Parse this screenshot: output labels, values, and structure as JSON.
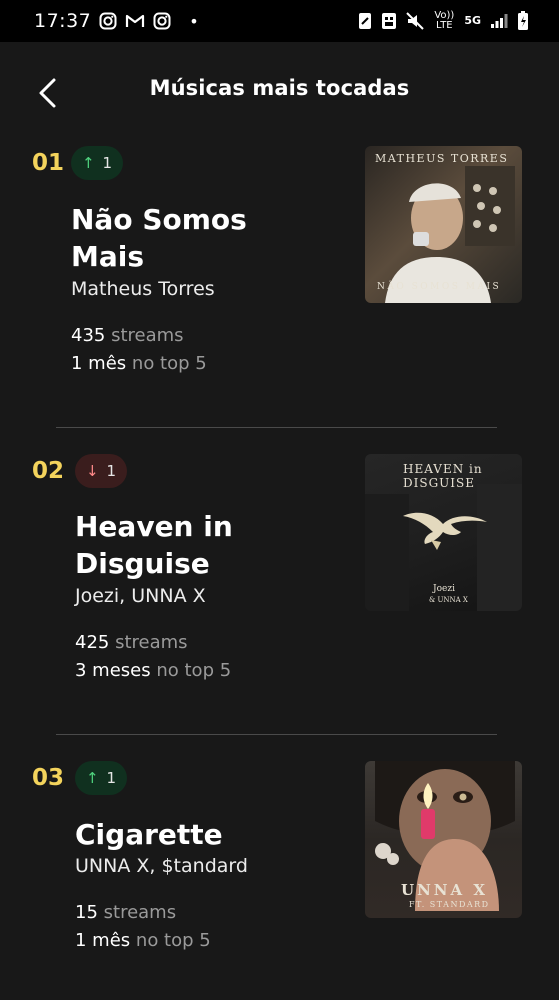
{
  "status_bar": {
    "time": "17:37",
    "dot": "•",
    "network_top": "Vo)) LTE",
    "network_5g": "5G",
    "icons": [
      "instagram-icon",
      "gmail-icon",
      "instagram-icon",
      "nfc-icon",
      "dual-sim-icon",
      "mute-icon",
      "signal-icon",
      "battery-icon"
    ]
  },
  "header": {
    "title": "Músicas mais tocadas"
  },
  "entries": [
    {
      "rank": "01",
      "trend": "up",
      "trend_change": "1",
      "song_line1": "Não Somos",
      "song_line2": "Mais",
      "artist": "Matheus Torres",
      "streams_count": "435",
      "streams_label": "streams",
      "top_duration": "1 mês",
      "top_label": "no top 5",
      "art_top_text": "MATHEUS TORRES",
      "art_bottom_text": "NÃO SOMOS MAIS"
    },
    {
      "rank": "02",
      "trend": "down",
      "trend_change": "1",
      "song_line1": "Heaven in",
      "song_line2": "Disguise",
      "artist": "Joezi, UNNA X",
      "streams_count": "425",
      "streams_label": "streams",
      "top_duration": "3 meses",
      "top_label": "no top 5",
      "art_title_1": "HEAVEN in",
      "art_title_2": "DISGUISE",
      "art_credit_1": "Joezi",
      "art_credit_2": "& UNNA X"
    },
    {
      "rank": "03",
      "trend": "up",
      "trend_change": "1",
      "song_line1": "Cigarette",
      "song_line2": "",
      "artist": "UNNA X, $tandard",
      "streams_count": "15",
      "streams_label": "streams",
      "top_duration": "1 mês",
      "top_label": "no top 5",
      "art_title": "UNNA X",
      "art_sub": "FT. STANDARD"
    }
  ],
  "colors": {
    "background": "#181818",
    "rank": "#f3d35c",
    "trend_up": "#4fd17e",
    "trend_down": "#ff8a8a",
    "muted": "#9a9a9a"
  }
}
